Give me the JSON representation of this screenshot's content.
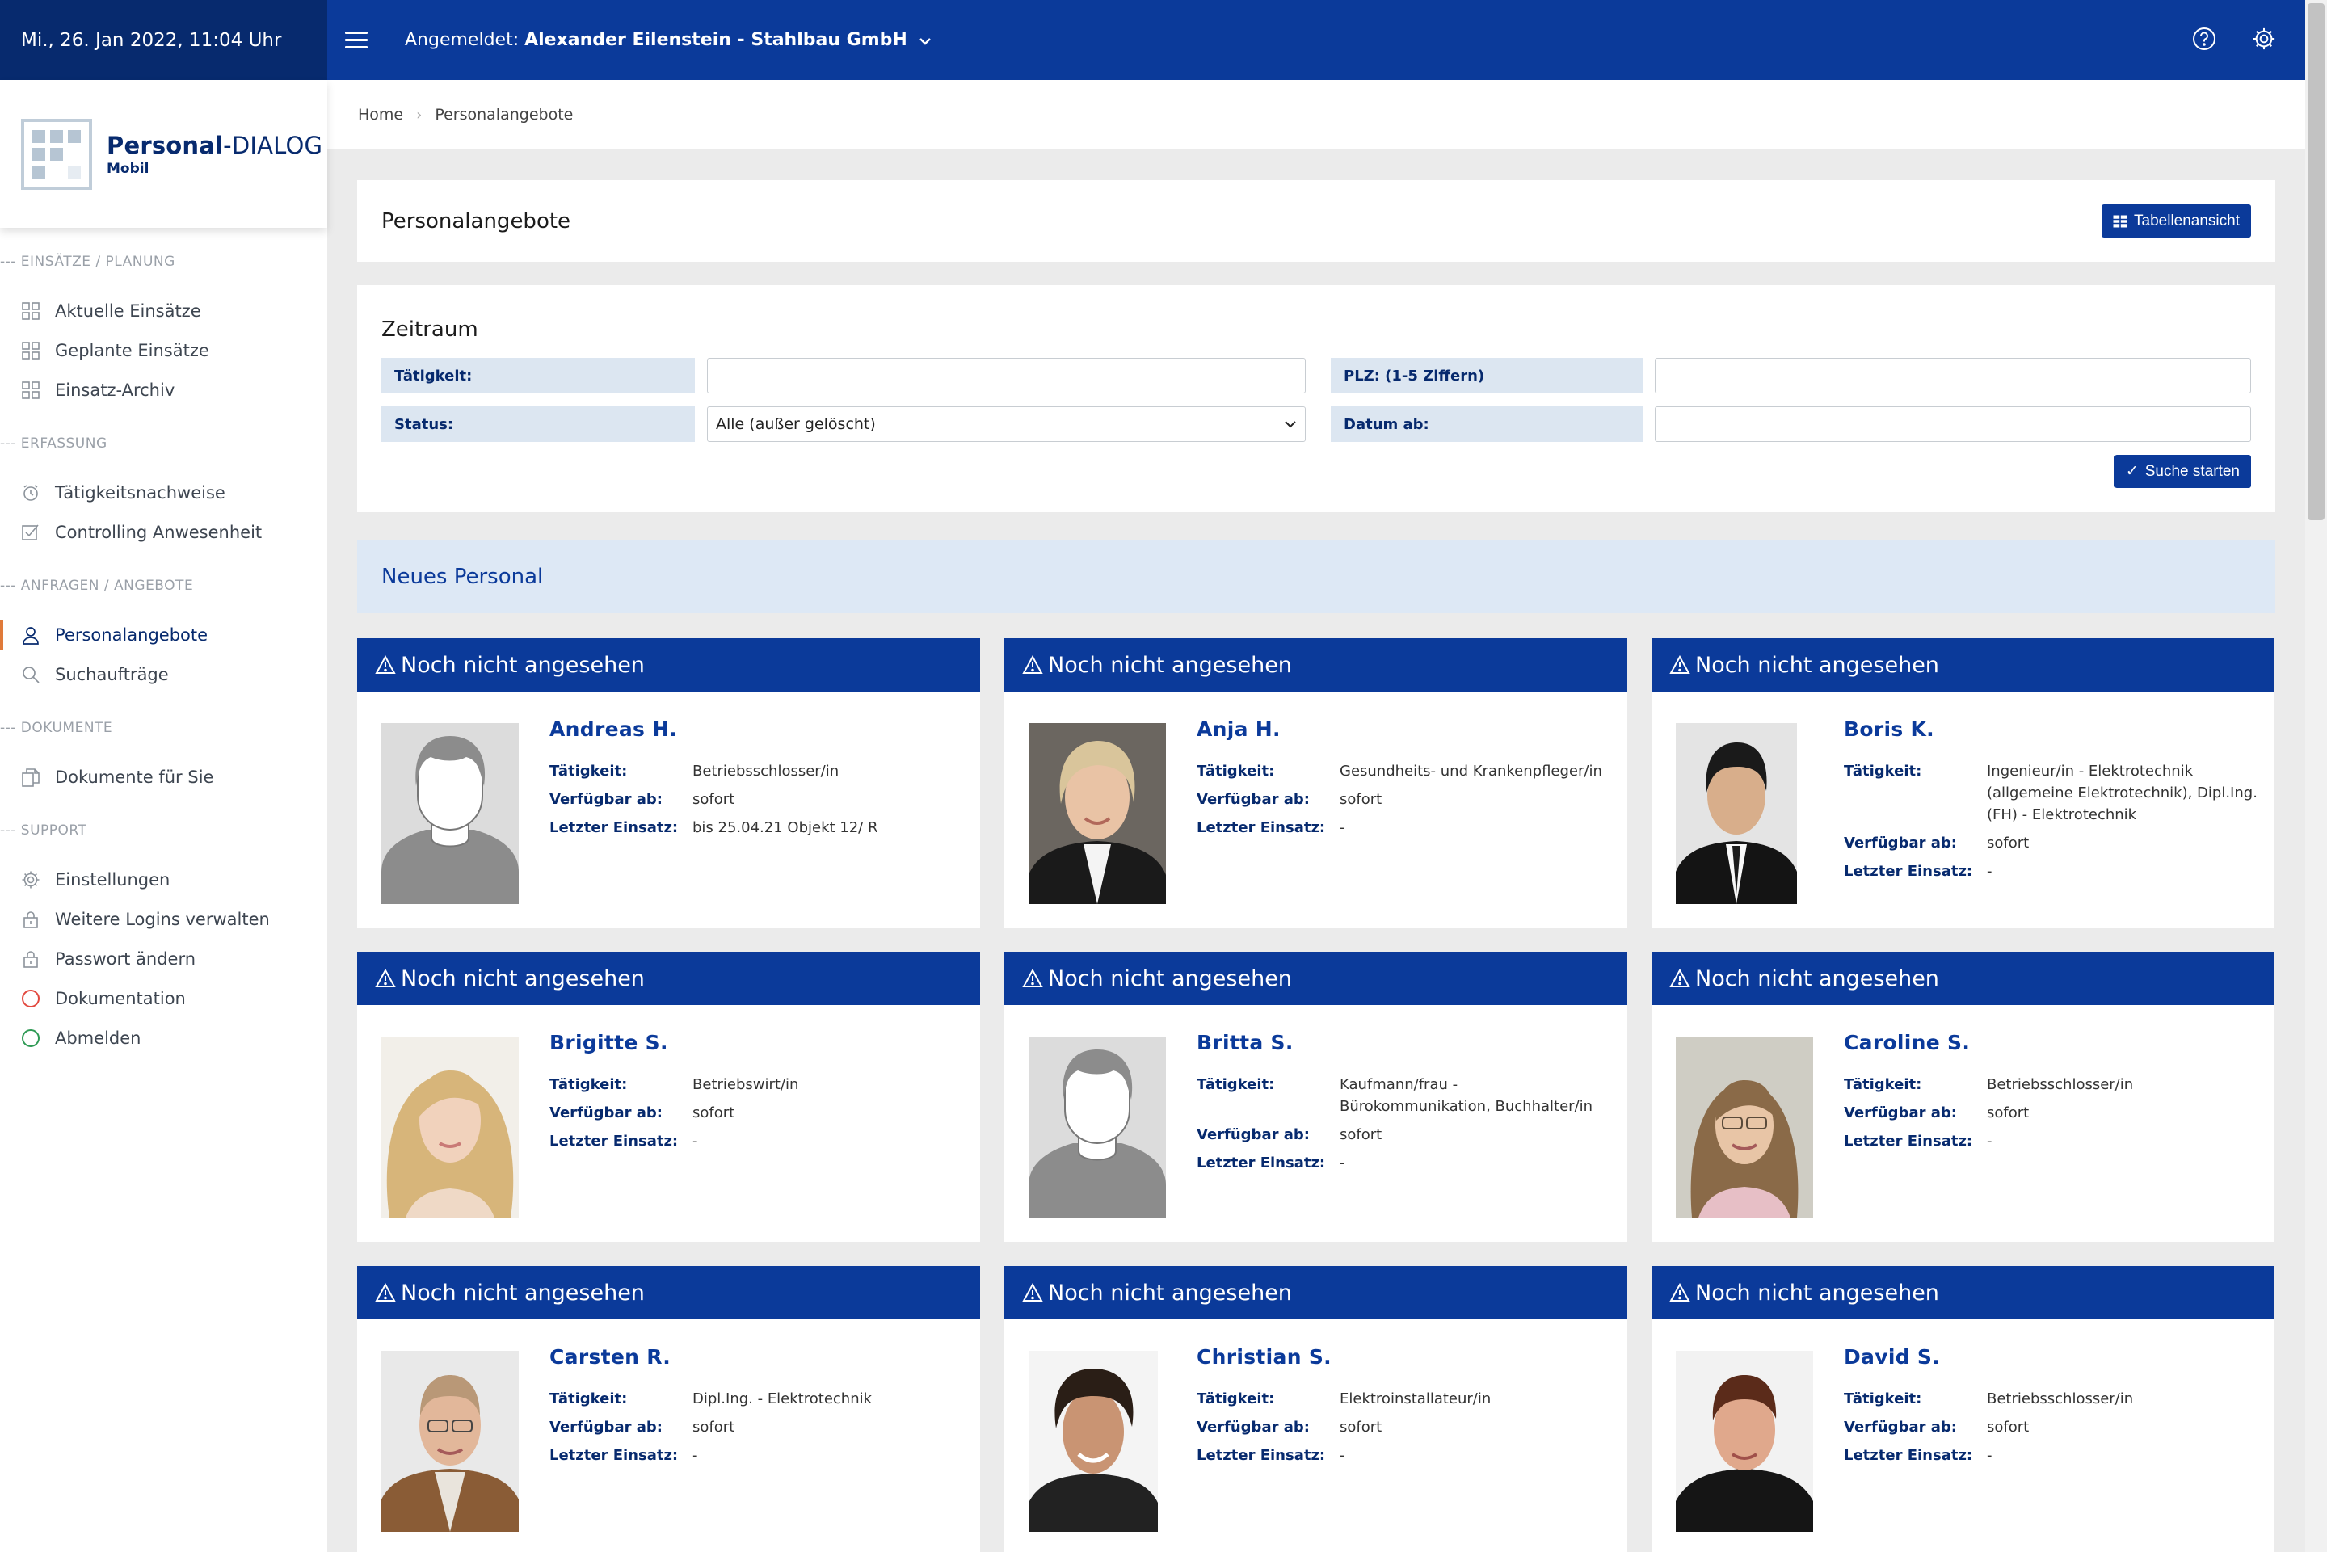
{
  "sidebar": {
    "datetime": "Mi., 26. Jan 2022, 11:04 Uhr",
    "logo": {
      "main_bold": "Personal",
      "main_thin": "-DIALOG",
      "sub": "Mobil"
    },
    "sections": [
      {
        "title": "--- EINSÄTZE / PLANUNG",
        "items": [
          {
            "label": "Aktuelle Einsätze",
            "icon": "grid-icon"
          },
          {
            "label": "Geplante Einsätze",
            "icon": "grid-icon"
          },
          {
            "label": "Einsatz-Archiv",
            "icon": "grid-icon"
          }
        ]
      },
      {
        "title": "--- ERFASSUNG",
        "items": [
          {
            "label": "Tätigkeitsnachweise",
            "icon": "clock-icon"
          },
          {
            "label": "Controlling Anwesenheit",
            "icon": "checkbox-icon"
          }
        ]
      },
      {
        "title": "--- ANFRAGEN / ANGEBOTE",
        "items": [
          {
            "label": "Personalangebote",
            "icon": "person-icon"
          },
          {
            "label": "Suchaufträge",
            "icon": "search-icon"
          }
        ]
      },
      {
        "title": "--- DOKUMENTE",
        "items": [
          {
            "label": "Dokumente für Sie",
            "icon": "documents-icon"
          }
        ]
      },
      {
        "title": "--- SUPPORT",
        "items": [
          {
            "label": "Einstellungen",
            "icon": "gear-icon"
          },
          {
            "label": "Weitere Logins verwalten",
            "icon": "lock-icon"
          },
          {
            "label": "Passwort ändern",
            "icon": "lock-icon"
          },
          {
            "label": "Dokumentation",
            "icon": "circle-red-icon"
          },
          {
            "label": "Abmelden",
            "icon": "circle-green-icon"
          }
        ]
      }
    ]
  },
  "topbar": {
    "logged_prefix": "Angemeldet:",
    "logged_user": "Alexander Eilenstein - Stahlbau GmbH"
  },
  "breadcrumb": {
    "home": "Home",
    "current": "Personalangebote"
  },
  "page": {
    "title": "Personalangebote",
    "table_button": "Tabellenansicht"
  },
  "filter": {
    "title": "Zeitraum",
    "taetigkeit_label": "Tätigkeit:",
    "taetigkeit_value": "",
    "plz_label": "PLZ: (1-5 Ziffern)",
    "plz_value": "",
    "status_label": "Status:",
    "status_value": "Alle (außer gelöscht)",
    "datum_label": "Datum ab:",
    "datum_value": "",
    "search_button": "Suche starten"
  },
  "neues_personal": "Neues Personal",
  "labels": {
    "taetigkeit": "Tätigkeit:",
    "verfuegbar": "Verfügbar ab:",
    "letzter": "Letzter Einsatz:"
  },
  "cards": [
    {
      "header": "Noch nicht angesehen",
      "name": "Andreas H.",
      "taetigkeit": "Betriebsschlosser/in",
      "verfuegbar": "sofort",
      "letzter": "bis 25.04.21 Objekt 12/ R",
      "photo": "placeholder"
    },
    {
      "header": "Noch nicht angesehen",
      "name": "Anja H.",
      "taetigkeit": "Gesundheits- und Krankenpfleger/in",
      "verfuegbar": "sofort",
      "letzter": "-",
      "photo": "woman-blonde"
    },
    {
      "header": "Noch nicht angesehen",
      "name": "Boris K.",
      "taetigkeit": "Ingenieur/in - Elektrotechnik (allgemeine Elektrotechnik), Dipl.Ing. (FH) - Elektrotechnik",
      "verfuegbar": "sofort",
      "letzter": "-",
      "photo": "man-dark-suit"
    },
    {
      "header": "Noch nicht angesehen",
      "name": "Brigitte S.",
      "taetigkeit": "Betriebswirt/in",
      "verfuegbar": "sofort",
      "letzter": "-",
      "photo": "woman-light"
    },
    {
      "header": "Noch nicht angesehen",
      "name": "Britta S.",
      "taetigkeit": "Kaufmann/frau - Bürokommunikation, Buchhalter/in",
      "verfuegbar": "sofort",
      "letzter": "-",
      "photo": "placeholder"
    },
    {
      "header": "Noch nicht angesehen",
      "name": "Caroline S.",
      "taetigkeit": "Betriebsschlosser/in",
      "verfuegbar": "sofort",
      "letzter": "-",
      "photo": "woman-brown"
    },
    {
      "header": "Noch nicht angesehen",
      "name": "Carsten R.",
      "taetigkeit": "Dipl.Ing. - Elektrotechnik",
      "verfuegbar": "sofort",
      "letzter": "-",
      "photo": "man-bald"
    },
    {
      "header": "Noch nicht angesehen",
      "name": "Christian S.",
      "taetigkeit": "Elektroinstallateur/in",
      "verfuegbar": "sofort",
      "letzter": "-",
      "photo": "man-curly"
    },
    {
      "header": "Noch nicht angesehen",
      "name": "David S.",
      "taetigkeit": "Betriebsschlosser/in",
      "verfuegbar": "sofort",
      "letzter": "-",
      "photo": "man-young"
    }
  ],
  "colors": {
    "navy": "#072a6e",
    "blue": "#0b3a9a",
    "label_bg": "#dce6f1",
    "accent": "#e07a3a"
  }
}
